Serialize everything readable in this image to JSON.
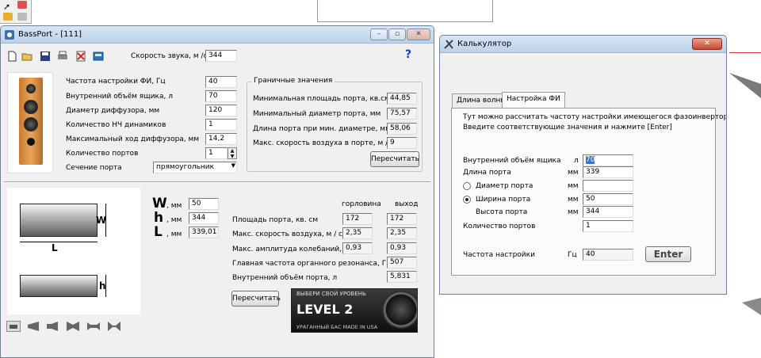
{
  "bass_port": {
    "title": "BassPort - [111]",
    "help_label": "?",
    "sound_speed": {
      "label": "Скорость звука, м /с",
      "value": "344"
    },
    "params": [
      {
        "label": "Частота настройки ФИ, Гц",
        "value": "40"
      },
      {
        "label": "Внутренний объём ящика, л",
        "value": "70"
      },
      {
        "label": "Диаметр диффузора, мм",
        "value": "120"
      },
      {
        "label": "Количество НЧ динамиков",
        "value": "1"
      },
      {
        "label": "Максимальный ход диффузора, мм",
        "value": "14,2"
      },
      {
        "label": "Количество портов",
        "value": "1"
      }
    ],
    "port_section": {
      "label": "Сечение порта",
      "value": "прямоугольник"
    },
    "limits": {
      "title": "Граничные значения",
      "rows": [
        {
          "label": "Минимальная площадь порта, кв.см.",
          "value": "44,85"
        },
        {
          "label": "Минимальный диаметр порта, мм",
          "value": "75,57"
        },
        {
          "label": "Длина порта при мин. диаметре, мм",
          "value": "58,06"
        },
        {
          "label": "Макс. скорость воздуха в порте, м /с",
          "value": "9"
        }
      ],
      "recalc_label": "Пересчитать"
    },
    "dims": {
      "w": {
        "letter": "W",
        "unit": ", мм",
        "value": "50"
      },
      "h": {
        "letter": "h",
        "unit": ", мм",
        "value": "344"
      },
      "l": {
        "letter": "L",
        "unit": ", мм",
        "value": "339,01"
      }
    },
    "diagram": {
      "w_label": "W",
      "l_label": "L",
      "h_label": "h"
    },
    "results": {
      "col_throat": "горловина",
      "col_exit": "выход",
      "rows": [
        {
          "label": "Площадь порта, кв. см",
          "throat": "172",
          "exit": "172"
        },
        {
          "label": "Макс. скорость воздуха, м / с",
          "throat": "2,35",
          "exit": "2,35"
        },
        {
          "label": "Макс. амплитуда колебаний, см",
          "throat": "0,93",
          "exit": "0,93"
        },
        {
          "label": "Главная частота органного резонанса, Гц",
          "throat": "507",
          "exit": ""
        },
        {
          "label": "Внутренний объём порта, л",
          "throat": "5,831",
          "exit": ""
        }
      ],
      "recalc_label": "Пересчитать"
    },
    "ad": {
      "line1": "ВЫБЕРИ СВОЙ УРОВЕНЬ",
      "line2": "LEVEL 2",
      "line3": "УРАГАННЫЙ БАС MADE IN USA"
    }
  },
  "calculator": {
    "title": "Калькулятор",
    "tabs": [
      {
        "label": "Длина волны"
      },
      {
        "label": "Настройка ФИ"
      }
    ],
    "intro": [
      "Тут можно рассчитать частоту настройки имеющегося фазоинвертора.",
      "Введите соответствующие значения и нажмите  [Enter]"
    ],
    "rows": {
      "box_volume": {
        "label": "Внутренний объём ящика",
        "unit": "л",
        "value": "70"
      },
      "port_length": {
        "label": "Длина порта",
        "unit": "мм",
        "value": "339"
      },
      "port_diameter": {
        "label": "Диаметр порта",
        "unit": "мм",
        "value": ""
      },
      "port_width": {
        "label": "Ширина порта",
        "unit": "мм",
        "value": "50"
      },
      "port_height": {
        "label": "Высота порта",
        "unit": "мм",
        "value": "344"
      },
      "port_count": {
        "label": "Количество портов",
        "unit": "",
        "value": "1"
      },
      "tuning": {
        "label": "Частота настройки",
        "unit": "Гц",
        "value": "40"
      }
    },
    "enter_label": "Enter"
  }
}
